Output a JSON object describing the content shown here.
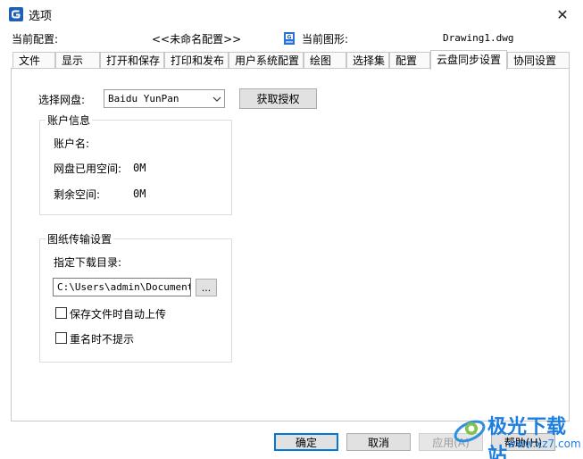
{
  "window": {
    "title": "选项",
    "close_glyph": "✕"
  },
  "header": {
    "profile_label": "当前配置:",
    "profile_value": "<<未命名配置>>",
    "drawing_label": "当前图形:",
    "drawing_value": "Drawing1.dwg"
  },
  "tabs": [
    {
      "label": "文件"
    },
    {
      "label": "显示"
    },
    {
      "label": "打开和保存"
    },
    {
      "label": "打印和发布"
    },
    {
      "label": "用户系统配置"
    },
    {
      "label": "绘图"
    },
    {
      "label": "选择集"
    },
    {
      "label": "配置"
    },
    {
      "label": "云盘同步设置",
      "active": true
    },
    {
      "label": "协同设置"
    }
  ],
  "cloud": {
    "select_label": "选择网盘:",
    "select_value": "Baidu YunPan",
    "authorize_button": "获取授权",
    "account_group": {
      "title": "账户信息",
      "username_label": "账户名:",
      "used_label": "网盘已用空间:",
      "used_value": "0M",
      "remaining_label": "剩余空间:",
      "remaining_value": "0M"
    },
    "transfer_group": {
      "title": "图纸传输设置",
      "download_dir_label": "指定下载目录:",
      "download_dir_value": "C:\\Users\\admin\\Documents\\",
      "browse_button": "...",
      "auto_upload_label": "保存文件时自动上传",
      "auto_upload_checked": false,
      "no_rename_prompt_label": "重名时不提示",
      "no_rename_prompt_checked": false
    }
  },
  "footer": {
    "ok": "确定",
    "cancel": "取消",
    "apply": "应用(A)",
    "help": "帮助(H)"
  },
  "watermark": {
    "text": "极光下载站",
    "url": "www.xz7.com"
  },
  "colors": {
    "accent": "#0078d7",
    "logo_blue": "#1f5fb4"
  }
}
